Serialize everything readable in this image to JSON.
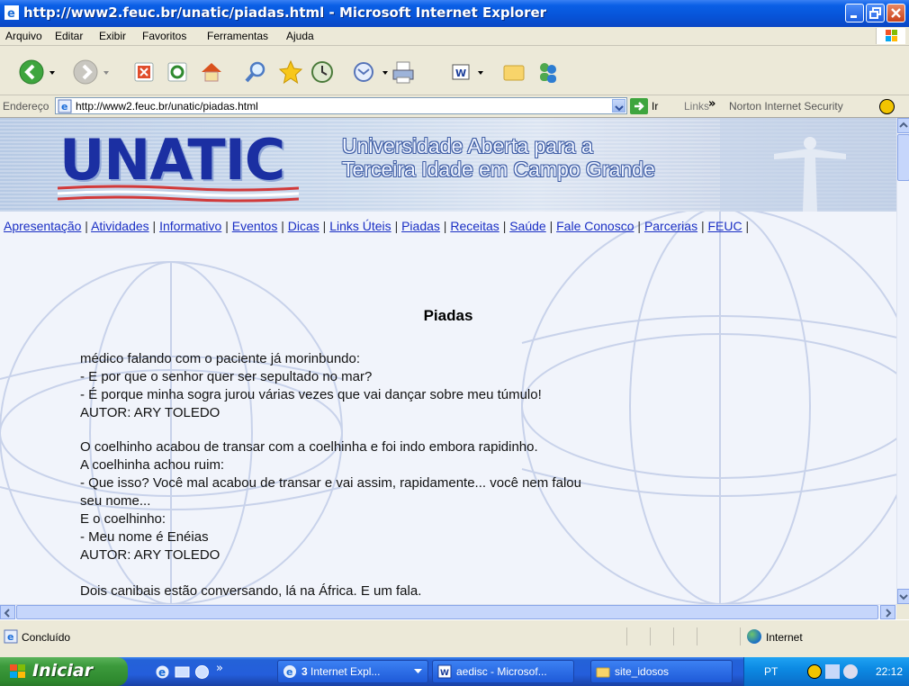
{
  "window": {
    "title": "http://www2.feuc.br/unatic/piadas.html - Microsoft Internet Explorer"
  },
  "menu": [
    "Arquivo",
    "Editar",
    "Exibir",
    "Favoritos",
    "Ferramentas",
    "Ajuda"
  ],
  "toolbar": {
    "icons": [
      "back-icon",
      "forward-icon",
      "stop-icon",
      "refresh-icon",
      "home-icon",
      "search-icon",
      "favorites-icon",
      "history-icon",
      "mail-icon",
      "print-icon",
      "edit-icon",
      "folder-icon",
      "messenger-icon"
    ]
  },
  "address": {
    "label": "Endereço",
    "url": "http://www2.feuc.br/unatic/piadas.html",
    "go_label": "Ir",
    "links_label": "Links",
    "links_chevron": "»",
    "norton_label": "Norton Internet Security"
  },
  "banner": {
    "logo": "UNATIC",
    "line1": "Universidade Aberta para a",
    "line2": "Terceira Idade em Campo Grande"
  },
  "nav": [
    "Apresentação",
    "Atividades",
    "Informativo",
    "Eventos",
    "Dicas",
    "Links Úteis",
    "Piadas",
    "Receitas",
    "Saúde",
    "Fale Conosco",
    "Parcerias",
    "FEUC"
  ],
  "content": {
    "title": "Piadas",
    "joke1": [
      "médico falando com o paciente já morinbundo:",
      "- E por que o senhor quer ser sepultado no mar?",
      "- É porque minha sogra jurou várias vezes que vai dançar sobre meu túmulo!",
      "AUTOR: ARY TOLEDO"
    ],
    "joke2": [
      "O coelhinho acabou de transar com a coelhinha e foi indo embora rapidinho.",
      "A coelhinha achou ruim:",
      "- Que isso? Você mal acabou de transar e vai assim, rapidamente... você nem falou",
      "seu nome...",
      "E o coelhinho:",
      "- Meu nome é Enéias",
      "AUTOR: ARY TOLEDO"
    ],
    "joke3": [
      "Dois canibais estão conversando, lá na África. E um fala."
    ]
  },
  "status": {
    "text": "Concluído",
    "zone": "Internet"
  },
  "taskbar": {
    "start_label": "Iniciar",
    "tasks": [
      {
        "count": "3",
        "label": "Internet Expl...",
        "icon": "ie-icon"
      },
      {
        "label": "aedisc - Microsof...",
        "icon": "word-icon"
      },
      {
        "label": "site_idosos",
        "icon": "folder-icon"
      }
    ],
    "language": "PT",
    "clock": "22:12"
  }
}
